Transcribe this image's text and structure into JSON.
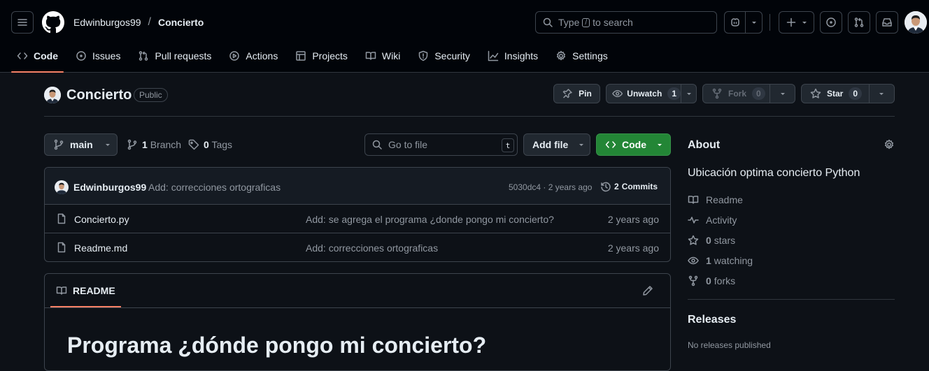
{
  "header": {
    "owner": "Edwinburgos99",
    "separator": "/",
    "repo": "Concierto",
    "search_pre": "Type",
    "search_key": "/",
    "search_post": "to search"
  },
  "nav": [
    {
      "label": "Code",
      "icon": "code-icon"
    },
    {
      "label": "Issues",
      "icon": "issue-icon"
    },
    {
      "label": "Pull requests",
      "icon": "pull-request-icon"
    },
    {
      "label": "Actions",
      "icon": "play-icon"
    },
    {
      "label": "Projects",
      "icon": "table-icon"
    },
    {
      "label": "Wiki",
      "icon": "book-icon"
    },
    {
      "label": "Security",
      "icon": "shield-icon"
    },
    {
      "label": "Insights",
      "icon": "graph-icon"
    },
    {
      "label": "Settings",
      "icon": "gear-icon"
    }
  ],
  "repo": {
    "name": "Concierto",
    "visibility": "Public",
    "pin_label": "Pin",
    "watch_label": "Unwatch",
    "watch_count": "1",
    "fork_label": "Fork",
    "fork_count": "0",
    "star_label": "Star",
    "star_count": "0"
  },
  "toolbar": {
    "branch": "main",
    "branches_count": "1",
    "branches_label": "Branch",
    "tags_count": "0",
    "tags_label": "Tags",
    "goto_placeholder": "Go to file",
    "goto_key": "t",
    "add_file": "Add file",
    "code": "Code"
  },
  "commit": {
    "author": "Edwinburgos99",
    "message": "Add: correcciones ortograficas",
    "meta": "5030dc4 · 2 years ago",
    "commits_count": "2",
    "commits_label": "Commits"
  },
  "files": [
    {
      "name": "Concierto.py",
      "message": "Add: se agrega el programa ¿donde pongo mi concierto?",
      "age": "2 years ago"
    },
    {
      "name": "Readme.md",
      "message": "Add: correcciones ortograficas",
      "age": "2 years ago"
    }
  ],
  "readme": {
    "tab": "README",
    "heading": "Programa ¿dónde pongo mi concierto?"
  },
  "about": {
    "title": "About",
    "description": "Ubicación optima concierto Python",
    "readme": "Readme",
    "activity": "Activity",
    "stars_count": "0",
    "stars_label": "stars",
    "watching_count": "1",
    "watching_label": "watching",
    "forks_count": "0",
    "forks_label": "forks"
  },
  "releases": {
    "title": "Releases",
    "empty": "No releases published"
  },
  "colors": {
    "background": "#0d1117",
    "header_bg": "#010409",
    "accent_underline": "#f78166",
    "code_button": "#238636",
    "border": "#3d444d",
    "muted_text": "#9198a1"
  }
}
